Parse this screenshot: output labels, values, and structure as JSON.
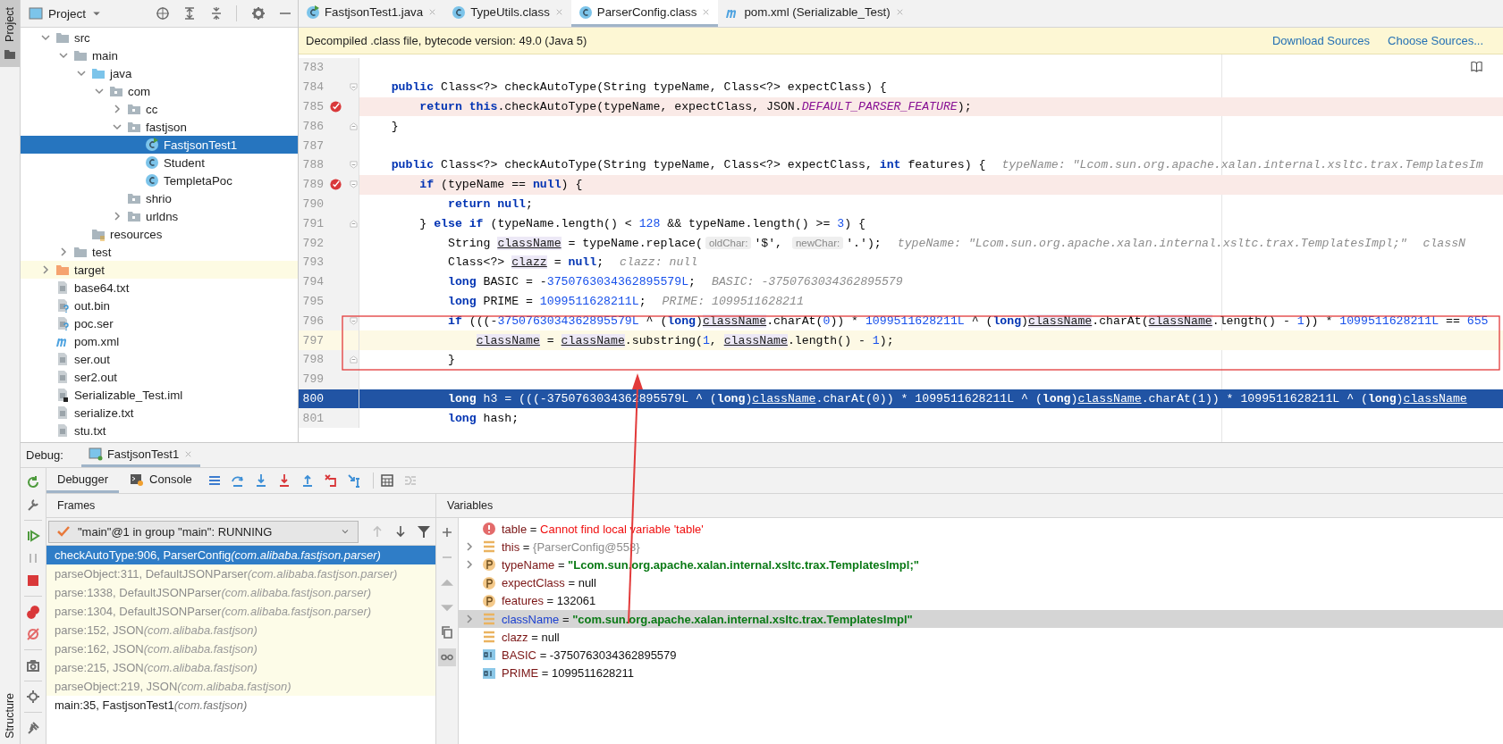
{
  "sidebar": {
    "top_tab": {
      "label": "Project",
      "selected": true
    },
    "bottom_tab": {
      "label": "Structure",
      "selected": false
    }
  },
  "project": {
    "title": "Project",
    "tree": [
      {
        "label": "src",
        "kind": "folder",
        "expanded": true,
        "selected": false,
        "children": [
          {
            "label": "main",
            "kind": "folder",
            "expanded": true,
            "selected": false,
            "children": [
              {
                "label": "java",
                "kind": "source-folder",
                "expanded": true,
                "selected": false,
                "children": [
                  {
                    "label": "com",
                    "kind": "package",
                    "expanded": true,
                    "selected": false,
                    "children": [
                      {
                        "label": "cc",
                        "kind": "package",
                        "expanded": false,
                        "selected": false
                      },
                      {
                        "label": "fastjson",
                        "kind": "package",
                        "expanded": true,
                        "selected": false,
                        "children": [
                          {
                            "label": "FastjsonTest1",
                            "kind": "runnable-class",
                            "selected": true
                          },
                          {
                            "label": "Student",
                            "kind": "class",
                            "selected": false
                          },
                          {
                            "label": "TempletaPoc",
                            "kind": "class",
                            "selected": false
                          }
                        ]
                      },
                      {
                        "label": "shrio",
                        "kind": "package",
                        "selected": false
                      },
                      {
                        "label": "urldns",
                        "kind": "package",
                        "expanded": false,
                        "selected": false
                      }
                    ]
                  }
                ]
              },
              {
                "label": "resources",
                "kind": "resource-folder",
                "selected": false
              }
            ]
          },
          {
            "label": "test",
            "kind": "folder",
            "expanded": false,
            "selected": false
          }
        ]
      },
      {
        "label": "target",
        "kind": "excluded-folder",
        "expanded": false,
        "selected": false
      },
      {
        "label": "base64.txt",
        "kind": "text-file",
        "selected": false
      },
      {
        "label": "out.bin",
        "kind": "unknown-file",
        "selected": false
      },
      {
        "label": "poc.ser",
        "kind": "unknown-file",
        "selected": false
      },
      {
        "label": "pom.xml",
        "kind": "maven-file",
        "selected": false
      },
      {
        "label": "ser.out",
        "kind": "text-file",
        "selected": false
      },
      {
        "label": "ser2.out",
        "kind": "text-file",
        "selected": false
      },
      {
        "label": "Serializable_Test.iml",
        "kind": "module-file",
        "selected": false
      },
      {
        "label": "serialize.txt",
        "kind": "text-file",
        "selected": false
      },
      {
        "label": "stu.txt",
        "kind": "text-file",
        "selected": false
      }
    ]
  },
  "editor": {
    "tabs": [
      {
        "label": "FastjsonTest1.java",
        "kind": "runnable-class",
        "selected": false
      },
      {
        "label": "TypeUtils.class",
        "kind": "class",
        "selected": false
      },
      {
        "label": "ParserConfig.class",
        "kind": "class",
        "selected": true
      },
      {
        "label": "pom.xml (Serializable_Test)",
        "kind": "maven-file",
        "selected": false
      }
    ],
    "banner": {
      "message": "Decompiled .class file, bytecode version: 49.0 (Java 5)",
      "links": [
        "Download Sources",
        "Choose Sources..."
      ]
    },
    "lines": [
      {
        "number": "783",
        "breakpoint": false,
        "caret": false,
        "execution": false,
        "fold_start": false,
        "fold_end": false
      },
      {
        "number": "784",
        "breakpoint": false,
        "caret": false,
        "execution": false,
        "fold_start": true,
        "fold_end": false,
        "tokens": [
          {
            "text": "    public",
            "kind": "keyword"
          },
          {
            "text": " Class<?> checkAutoType(String typeName, Class<?> expectClass) {",
            "kind": "plain"
          }
        ]
      },
      {
        "number": "785",
        "breakpoint": true,
        "caret": false,
        "execution": false,
        "fold_start": false,
        "fold_end": false,
        "tokens": [
          {
            "text": "        return this",
            "kind": "keyword"
          },
          {
            "text": ".checkAutoType(typeName, expectClass, JSON.",
            "kind": "plain"
          },
          {
            "text": "DEFAULT_PARSER_FEATURE",
            "kind": "constant"
          },
          {
            "text": ");",
            "kind": "plain"
          }
        ]
      },
      {
        "number": "786",
        "breakpoint": false,
        "caret": false,
        "execution": false,
        "fold_start": false,
        "fold_end": true,
        "tokens": [
          {
            "text": "    }",
            "kind": "plain"
          }
        ]
      },
      {
        "number": "787",
        "breakpoint": false,
        "caret": false,
        "execution": false,
        "fold_start": false,
        "fold_end": false
      },
      {
        "number": "788",
        "breakpoint": false,
        "caret": false,
        "execution": false,
        "fold_start": true,
        "fold_end": false,
        "tokens": [
          {
            "text": "    public",
            "kind": "keyword"
          },
          {
            "text": " Class<?> checkAutoType(String typeName, Class<?> expectClass, ",
            "kind": "plain"
          },
          {
            "text": "int",
            "kind": "keyword"
          },
          {
            "text": " features) {",
            "kind": "plain"
          },
          {
            "text": "typeName: \"Lcom.sun.org.apache.xalan.internal.xsltc.trax.TemplatesIm",
            "kind": "value-hint"
          }
        ]
      },
      {
        "number": "789",
        "breakpoint": true,
        "caret": false,
        "execution": false,
        "fold_start": true,
        "fold_end": false,
        "tokens": [
          {
            "text": "        if",
            "kind": "keyword"
          },
          {
            "text": " (typeName == ",
            "kind": "plain"
          },
          {
            "text": "null",
            "kind": "keyword"
          },
          {
            "text": ") {",
            "kind": "plain"
          }
        ]
      },
      {
        "number": "790",
        "breakpoint": false,
        "caret": false,
        "execution": false,
        "fold_start": false,
        "fold_end": false,
        "tokens": [
          {
            "text": "            return null",
            "kind": "keyword"
          },
          {
            "text": ";",
            "kind": "plain"
          }
        ]
      },
      {
        "number": "791",
        "breakpoint": false,
        "caret": false,
        "execution": false,
        "fold_start": false,
        "fold_end": true,
        "tokens": [
          {
            "text": "        } ",
            "kind": "plain"
          },
          {
            "text": "else if",
            "kind": "keyword"
          },
          {
            "text": " (typeName.length() < ",
            "kind": "plain"
          },
          {
            "text": "128",
            "kind": "number"
          },
          {
            "text": " && typeName.length() >= ",
            "kind": "plain"
          },
          {
            "text": "3",
            "kind": "number"
          },
          {
            "text": ") {",
            "kind": "plain"
          }
        ]
      },
      {
        "number": "792",
        "breakpoint": false,
        "caret": false,
        "execution": false,
        "fold_start": false,
        "fold_end": false,
        "tokens": [
          {
            "text": "            String ",
            "kind": "plain"
          },
          {
            "text": "className",
            "kind": "variable"
          },
          {
            "text": " = typeName.replace(",
            "kind": "plain"
          },
          {
            "text": "oldChar:",
            "kind": "param-hint"
          },
          {
            "text": "'$', ",
            "kind": "plain"
          },
          {
            "text": "newChar:",
            "kind": "param-hint"
          },
          {
            "text": "'.');",
            "kind": "plain"
          },
          {
            "text": "typeName: \"Lcom.sun.org.apache.xalan.internal.xsltc.trax.TemplatesImpl;\"",
            "kind": "value-hint"
          },
          {
            "text": "classN",
            "kind": "value-hint"
          }
        ]
      },
      {
        "number": "793",
        "breakpoint": false,
        "caret": false,
        "execution": false,
        "fold_start": false,
        "fold_end": false,
        "tokens": [
          {
            "text": "            Class<?> ",
            "kind": "plain"
          },
          {
            "text": "clazz",
            "kind": "variable"
          },
          {
            "text": " = ",
            "kind": "plain"
          },
          {
            "text": "null",
            "kind": "keyword"
          },
          {
            "text": ";",
            "kind": "plain"
          },
          {
            "text": "clazz: null",
            "kind": "value-hint"
          }
        ]
      },
      {
        "number": "794",
        "breakpoint": false,
        "caret": false,
        "execution": false,
        "fold_start": false,
        "fold_end": false,
        "tokens": [
          {
            "text": "            long",
            "kind": "keyword"
          },
          {
            "text": " BASIC = -",
            "kind": "plain"
          },
          {
            "text": "3750763034362895579L",
            "kind": "number"
          },
          {
            "text": ";",
            "kind": "plain"
          },
          {
            "text": "BASIC: -3750763034362895579",
            "kind": "value-hint"
          }
        ]
      },
      {
        "number": "795",
        "breakpoint": false,
        "caret": false,
        "execution": false,
        "fold_start": false,
        "fold_end": false,
        "tokens": [
          {
            "text": "            long",
            "kind": "keyword"
          },
          {
            "text": " PRIME = ",
            "kind": "plain"
          },
          {
            "text": "1099511628211L",
            "kind": "number"
          },
          {
            "text": ";",
            "kind": "plain"
          },
          {
            "text": "PRIME: 1099511628211",
            "kind": "value-hint"
          }
        ]
      },
      {
        "number": "796",
        "breakpoint": false,
        "caret": false,
        "execution": false,
        "fold_start": true,
        "fold_end": false,
        "tokens": [
          {
            "text": "            if",
            "kind": "keyword"
          },
          {
            "text": " (((-",
            "kind": "plain"
          },
          {
            "text": "3750763034362895579L",
            "kind": "number"
          },
          {
            "text": " ^ (",
            "kind": "plain"
          },
          {
            "text": "long",
            "kind": "keyword"
          },
          {
            "text": ")",
            "kind": "plain"
          },
          {
            "text": "className",
            "kind": "variable"
          },
          {
            "text": ".charAt(",
            "kind": "plain"
          },
          {
            "text": "0",
            "kind": "number"
          },
          {
            "text": ")) * ",
            "kind": "plain"
          },
          {
            "text": "1099511628211L",
            "kind": "number"
          },
          {
            "text": " ^ (",
            "kind": "plain"
          },
          {
            "text": "long",
            "kind": "keyword"
          },
          {
            "text": ")",
            "kind": "plain"
          },
          {
            "text": "className",
            "kind": "variable"
          },
          {
            "text": ".charAt(",
            "kind": "plain"
          },
          {
            "text": "className",
            "kind": "variable"
          },
          {
            "text": ".length() - ",
            "kind": "plain"
          },
          {
            "text": "1",
            "kind": "number"
          },
          {
            "text": ")) * ",
            "kind": "plain"
          },
          {
            "text": "1099511628211L",
            "kind": "number"
          },
          {
            "text": " == ",
            "kind": "plain"
          },
          {
            "text": "655",
            "kind": "number"
          }
        ]
      },
      {
        "number": "797",
        "breakpoint": false,
        "caret": true,
        "execution": false,
        "fold_start": false,
        "fold_end": false,
        "tokens": [
          {
            "text": "                className",
            "kind": "variable"
          },
          {
            "text": " = ",
            "kind": "plain"
          },
          {
            "text": "className",
            "kind": "variable"
          },
          {
            "text": ".substring(",
            "kind": "plain"
          },
          {
            "text": "1",
            "kind": "number"
          },
          {
            "text": ", ",
            "kind": "plain"
          },
          {
            "text": "className",
            "kind": "variable"
          },
          {
            "text": ".length() - ",
            "kind": "plain"
          },
          {
            "text": "1",
            "kind": "number"
          },
          {
            "text": ");",
            "kind": "plain"
          }
        ]
      },
      {
        "number": "798",
        "breakpoint": false,
        "caret": false,
        "execution": false,
        "fold_start": false,
        "fold_end": true,
        "tokens": [
          {
            "text": "            }",
            "kind": "plain"
          }
        ]
      },
      {
        "number": "799",
        "breakpoint": false,
        "caret": false,
        "execution": false,
        "fold_start": false,
        "fold_end": false
      },
      {
        "number": "800",
        "breakpoint": false,
        "caret": false,
        "execution": true,
        "fold_start": false,
        "fold_end": false,
        "tokens": [
          {
            "text": "            long",
            "kind": "keyword"
          },
          {
            "text": " h3 = (((-",
            "kind": "plain"
          },
          {
            "text": "3750763034362895579L",
            "kind": "number"
          },
          {
            "text": " ^ (",
            "kind": "plain"
          },
          {
            "text": "long",
            "kind": "keyword"
          },
          {
            "text": ")",
            "kind": "plain"
          },
          {
            "text": "className",
            "kind": "variable"
          },
          {
            "text": ".charAt(",
            "kind": "plain"
          },
          {
            "text": "0",
            "kind": "number"
          },
          {
            "text": ")) * ",
            "kind": "plain"
          },
          {
            "text": "1099511628211L",
            "kind": "number"
          },
          {
            "text": " ^ (",
            "kind": "plain"
          },
          {
            "text": "long",
            "kind": "keyword"
          },
          {
            "text": ")",
            "kind": "plain"
          },
          {
            "text": "className",
            "kind": "variable"
          },
          {
            "text": ".charAt(",
            "kind": "plain"
          },
          {
            "text": "1",
            "kind": "number"
          },
          {
            "text": ")) * ",
            "kind": "plain"
          },
          {
            "text": "1099511628211L",
            "kind": "number"
          },
          {
            "text": " ^ (",
            "kind": "plain"
          },
          {
            "text": "long",
            "kind": "keyword"
          },
          {
            "text": ")",
            "kind": "plain"
          },
          {
            "text": "className",
            "kind": "variable"
          }
        ]
      },
      {
        "number": "801",
        "breakpoint": false,
        "caret": false,
        "execution": false,
        "fold_start": false,
        "fold_end": false,
        "tokens": [
          {
            "text": "            long",
            "kind": "keyword"
          },
          {
            "text": " hash;",
            "kind": "plain"
          }
        ]
      }
    ]
  },
  "debug": {
    "label": "Debug:",
    "tabs": [
      {
        "label": "FastjsonTest1",
        "selected": true
      }
    ],
    "subtabs": [
      {
        "label": "Debugger",
        "kind": "debugger",
        "selected": true
      },
      {
        "label": "Console",
        "kind": "console",
        "selected": false
      }
    ],
    "frames": {
      "title": "Frames",
      "thread": "\"main\"@1 in group \"main\": RUNNING",
      "items": [
        {
          "method": "checkAutoType:906, ParserConfig",
          "package": "(com.alibaba.fastjson.parser)",
          "selected": true,
          "library": false
        },
        {
          "method": "parseObject:311, DefaultJSONParser",
          "package": "(com.alibaba.fastjson.parser)",
          "selected": false,
          "library": true
        },
        {
          "method": "parse:1338, DefaultJSONParser",
          "package": "(com.alibaba.fastjson.parser)",
          "selected": false,
          "library": true
        },
        {
          "method": "parse:1304, DefaultJSONParser",
          "package": "(com.alibaba.fastjson.parser)",
          "selected": false,
          "library": true
        },
        {
          "method": "parse:152, JSON",
          "package": "(com.alibaba.fastjson)",
          "selected": false,
          "library": true
        },
        {
          "method": "parse:162, JSON",
          "package": "(com.alibaba.fastjson)",
          "selected": false,
          "library": true
        },
        {
          "method": "parse:215, JSON",
          "package": "(com.alibaba.fastjson)",
          "selected": false,
          "library": true
        },
        {
          "method": "parseObject:219, JSON",
          "package": "(com.alibaba.fastjson)",
          "selected": false,
          "library": true
        },
        {
          "method": "main:35, FastjsonTest1",
          "package": "(com.fastjson)",
          "selected": false,
          "library": false
        }
      ]
    },
    "variables": {
      "title": "Variables",
      "items": [
        {
          "name": "table",
          "eq": "=",
          "value": {
            "text": "Cannot find local variable 'table'",
            "kind": "error"
          },
          "kind": "error",
          "selected": false,
          "changed": false
        },
        {
          "name": "this",
          "eq": "=",
          "value": {
            "text": "{ParserConfig@558}",
            "kind": "object"
          },
          "kind": "local",
          "expanded": false,
          "selected": false,
          "changed": false
        },
        {
          "name": "typeName",
          "eq": "=",
          "value": {
            "text": "\"Lcom.sun.org.apache.xalan.internal.xsltc.trax.TemplatesImpl;\"",
            "kind": "string"
          },
          "kind": "parameter",
          "expanded": false,
          "selected": false,
          "changed": false
        },
        {
          "name": "expectClass",
          "eq": "=",
          "value": {
            "text": "null",
            "kind": "plain"
          },
          "kind": "parameter",
          "selected": false,
          "changed": false
        },
        {
          "name": "features",
          "eq": "=",
          "value": {
            "text": "132061",
            "kind": "plain"
          },
          "kind": "parameter",
          "selected": false,
          "changed": false
        },
        {
          "name": "className",
          "eq": "=",
          "value": {
            "text": "\"com.sun.org.apache.xalan.internal.xsltc.trax.TemplatesImpl\"",
            "kind": "string"
          },
          "kind": "local",
          "expanded": false,
          "selected": true,
          "changed": true
        },
        {
          "name": "clazz",
          "eq": "=",
          "value": {
            "text": "null",
            "kind": "plain"
          },
          "kind": "local",
          "selected": false,
          "changed": false
        },
        {
          "name": "BASIC",
          "eq": "=",
          "value": {
            "text": "-3750763034362895579",
            "kind": "plain"
          },
          "kind": "primitive",
          "selected": false,
          "changed": false
        },
        {
          "name": "PRIME",
          "eq": "=",
          "value": {
            "text": "1099511628211",
            "kind": "plain"
          },
          "kind": "primitive",
          "selected": false,
          "changed": false
        }
      ]
    }
  }
}
